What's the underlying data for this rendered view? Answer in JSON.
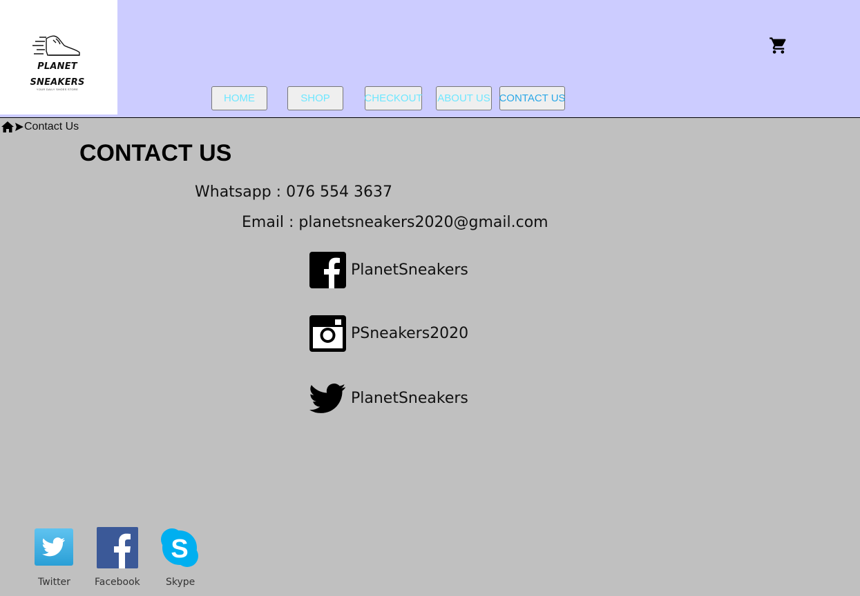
{
  "logo": {
    "line1": "PLANET",
    "line2": "SNEAKERS",
    "tagline": "YOUR DAILY SHOES STORE"
  },
  "nav": {
    "home": "HOME",
    "shop": "SHOP",
    "checkout": "CHECKOUT",
    "about": "ABOUT US",
    "contact": "CONTACT US"
  },
  "icons": {
    "cart": "shopping-cart-icon",
    "home": "home-icon",
    "breadcrumb_separator": "chevron-right-icon"
  },
  "breadcrumb": {
    "current": "Contact Us"
  },
  "page": {
    "title": "CONTACT US"
  },
  "contact": {
    "whatsapp": "Whatsapp : 076 554 3637",
    "email": "Email : planetsneakers2020@gmail.com",
    "facebook": "PlanetSneakers",
    "instagram": "PSneakers2020",
    "twitter": "PlanetSneakers"
  },
  "footer": {
    "twitter": "Twitter",
    "facebook": "Facebook",
    "skype": "Skype"
  },
  "colors": {
    "header_bg": "#ccccff",
    "page_bg": "#c0c0c0",
    "nav_text": "#6fe7ff",
    "nav_active_text": "#2aa7e7",
    "twitter_blue": "#1da1f2",
    "facebook_blue": "#3b5998",
    "skype_blue": "#00aff0"
  }
}
